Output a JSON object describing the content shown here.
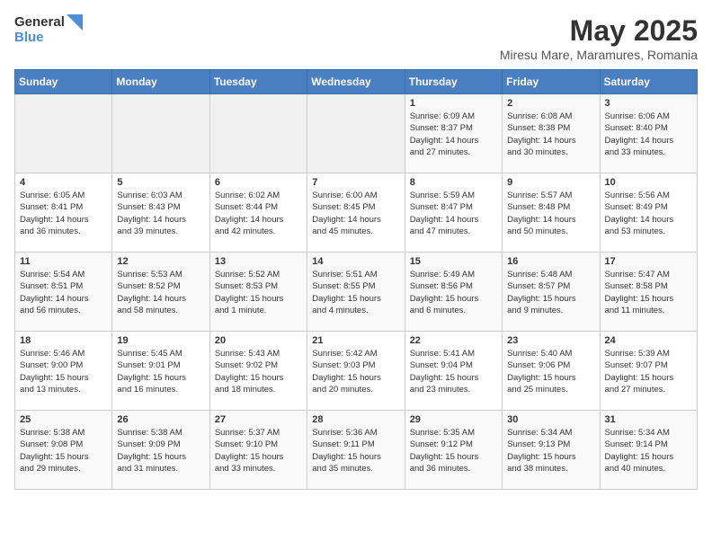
{
  "logo": {
    "general": "General",
    "blue": "Blue"
  },
  "title": "May 2025",
  "subtitle": "Miresu Mare, Maramures, Romania",
  "days_of_week": [
    "Sunday",
    "Monday",
    "Tuesday",
    "Wednesday",
    "Thursday",
    "Friday",
    "Saturday"
  ],
  "weeks": [
    [
      {
        "day": "",
        "info": ""
      },
      {
        "day": "",
        "info": ""
      },
      {
        "day": "",
        "info": ""
      },
      {
        "day": "",
        "info": ""
      },
      {
        "day": "1",
        "info": "Sunrise: 6:09 AM\nSunset: 8:37 PM\nDaylight: 14 hours\nand 27 minutes."
      },
      {
        "day": "2",
        "info": "Sunrise: 6:08 AM\nSunset: 8:38 PM\nDaylight: 14 hours\nand 30 minutes."
      },
      {
        "day": "3",
        "info": "Sunrise: 6:06 AM\nSunset: 8:40 PM\nDaylight: 14 hours\nand 33 minutes."
      }
    ],
    [
      {
        "day": "4",
        "info": "Sunrise: 6:05 AM\nSunset: 8:41 PM\nDaylight: 14 hours\nand 36 minutes."
      },
      {
        "day": "5",
        "info": "Sunrise: 6:03 AM\nSunset: 8:43 PM\nDaylight: 14 hours\nand 39 minutes."
      },
      {
        "day": "6",
        "info": "Sunrise: 6:02 AM\nSunset: 8:44 PM\nDaylight: 14 hours\nand 42 minutes."
      },
      {
        "day": "7",
        "info": "Sunrise: 6:00 AM\nSunset: 8:45 PM\nDaylight: 14 hours\nand 45 minutes."
      },
      {
        "day": "8",
        "info": "Sunrise: 5:59 AM\nSunset: 8:47 PM\nDaylight: 14 hours\nand 47 minutes."
      },
      {
        "day": "9",
        "info": "Sunrise: 5:57 AM\nSunset: 8:48 PM\nDaylight: 14 hours\nand 50 minutes."
      },
      {
        "day": "10",
        "info": "Sunrise: 5:56 AM\nSunset: 8:49 PM\nDaylight: 14 hours\nand 53 minutes."
      }
    ],
    [
      {
        "day": "11",
        "info": "Sunrise: 5:54 AM\nSunset: 8:51 PM\nDaylight: 14 hours\nand 56 minutes."
      },
      {
        "day": "12",
        "info": "Sunrise: 5:53 AM\nSunset: 8:52 PM\nDaylight: 14 hours\nand 58 minutes."
      },
      {
        "day": "13",
        "info": "Sunrise: 5:52 AM\nSunset: 8:53 PM\nDaylight: 15 hours\nand 1 minute."
      },
      {
        "day": "14",
        "info": "Sunrise: 5:51 AM\nSunset: 8:55 PM\nDaylight: 15 hours\nand 4 minutes."
      },
      {
        "day": "15",
        "info": "Sunrise: 5:49 AM\nSunset: 8:56 PM\nDaylight: 15 hours\nand 6 minutes."
      },
      {
        "day": "16",
        "info": "Sunrise: 5:48 AM\nSunset: 8:57 PM\nDaylight: 15 hours\nand 9 minutes."
      },
      {
        "day": "17",
        "info": "Sunrise: 5:47 AM\nSunset: 8:58 PM\nDaylight: 15 hours\nand 11 minutes."
      }
    ],
    [
      {
        "day": "18",
        "info": "Sunrise: 5:46 AM\nSunset: 9:00 PM\nDaylight: 15 hours\nand 13 minutes."
      },
      {
        "day": "19",
        "info": "Sunrise: 5:45 AM\nSunset: 9:01 PM\nDaylight: 15 hours\nand 16 minutes."
      },
      {
        "day": "20",
        "info": "Sunrise: 5:43 AM\nSunset: 9:02 PM\nDaylight: 15 hours\nand 18 minutes."
      },
      {
        "day": "21",
        "info": "Sunrise: 5:42 AM\nSunset: 9:03 PM\nDaylight: 15 hours\nand 20 minutes."
      },
      {
        "day": "22",
        "info": "Sunrise: 5:41 AM\nSunset: 9:04 PM\nDaylight: 15 hours\nand 23 minutes."
      },
      {
        "day": "23",
        "info": "Sunrise: 5:40 AM\nSunset: 9:06 PM\nDaylight: 15 hours\nand 25 minutes."
      },
      {
        "day": "24",
        "info": "Sunrise: 5:39 AM\nSunset: 9:07 PM\nDaylight: 15 hours\nand 27 minutes."
      }
    ],
    [
      {
        "day": "25",
        "info": "Sunrise: 5:38 AM\nSunset: 9:08 PM\nDaylight: 15 hours\nand 29 minutes."
      },
      {
        "day": "26",
        "info": "Sunrise: 5:38 AM\nSunset: 9:09 PM\nDaylight: 15 hours\nand 31 minutes."
      },
      {
        "day": "27",
        "info": "Sunrise: 5:37 AM\nSunset: 9:10 PM\nDaylight: 15 hours\nand 33 minutes."
      },
      {
        "day": "28",
        "info": "Sunrise: 5:36 AM\nSunset: 9:11 PM\nDaylight: 15 hours\nand 35 minutes."
      },
      {
        "day": "29",
        "info": "Sunrise: 5:35 AM\nSunset: 9:12 PM\nDaylight: 15 hours\nand 36 minutes."
      },
      {
        "day": "30",
        "info": "Sunrise: 5:34 AM\nSunset: 9:13 PM\nDaylight: 15 hours\nand 38 minutes."
      },
      {
        "day": "31",
        "info": "Sunrise: 5:34 AM\nSunset: 9:14 PM\nDaylight: 15 hours\nand 40 minutes."
      }
    ]
  ]
}
